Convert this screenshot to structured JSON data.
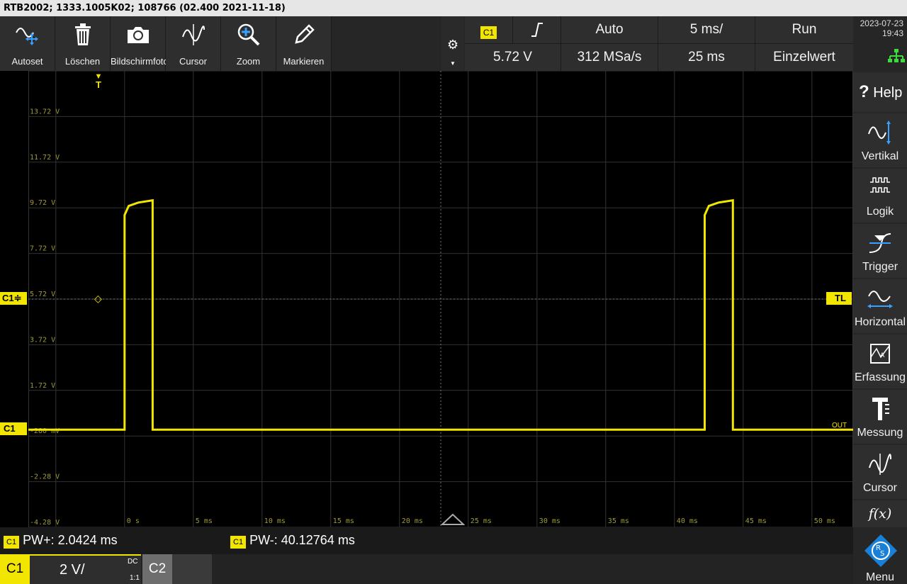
{
  "title_bar": "RTB2002; 1333.1005K02; 108766 (02.400 2021-11-18)",
  "toolbar": [
    {
      "icon": "autoset-icon",
      "label": "Autoset"
    },
    {
      "icon": "trash-icon",
      "label": "Löschen"
    },
    {
      "icon": "camera-icon",
      "label": "Bildschirmfoto"
    },
    {
      "icon": "cursor-wave-icon",
      "label": "Cursor"
    },
    {
      "icon": "zoom-icon",
      "label": "Zoom"
    },
    {
      "icon": "pencil-icon",
      "label": "Markieren"
    }
  ],
  "info": {
    "trigger_source": "C1",
    "trigger_slope_icon": "rising-edge-icon",
    "trigger_mode": "Auto",
    "time_per_div": "5 ms/",
    "run_state": "Run",
    "trigger_level": "5.72 V",
    "sample_rate": "312 MSa/s",
    "time_offset": "25 ms",
    "acquisition": "Einzelwert"
  },
  "datetime": {
    "date": "2023-07-23",
    "time": "19:43"
  },
  "sidebar": [
    {
      "icon": "help-icon",
      "label": "Help"
    },
    {
      "icon": "vertical-icon",
      "label": "Vertikal"
    },
    {
      "icon": "logic-icon",
      "label": "Logik"
    },
    {
      "icon": "trigger-icon",
      "label": "Trigger"
    },
    {
      "icon": "horizontal-icon",
      "label": "Horizontal"
    },
    {
      "icon": "acquisition-icon",
      "label": "Erfassung"
    },
    {
      "icon": "measure-icon",
      "label": "Messung"
    },
    {
      "icon": "cursor-icon",
      "label": "Cursor"
    },
    {
      "icon": "math-icon",
      "label": "f(x)"
    },
    {
      "icon": "rs-logo-icon",
      "label": "Menu"
    }
  ],
  "markers": {
    "trigger_time": "T",
    "trigger_level": "TL",
    "channel_level": "C1≑",
    "channel_ground": "C1",
    "out": "OUT"
  },
  "colors": {
    "trace": "#f2e600",
    "grid": "#3a3a3a",
    "accent": "#f2e600"
  },
  "chart_data": {
    "type": "line",
    "x_unit": "ms",
    "y_unit": "V",
    "xlim": [
      -7,
      53
    ],
    "ylim": [
      -4.28,
      15.72
    ],
    "x_ticks": [
      "0 s",
      "5 ms",
      "10 ms",
      "15 ms",
      "20 ms",
      "25 ms",
      "30 ms",
      "35 ms",
      "40 ms",
      "45 ms",
      "50 ms"
    ],
    "y_ticks": [
      "13.72 V",
      "11.72 V",
      "9.72 V",
      "7.72 V",
      "5.72 V",
      "3.72 V",
      "1.72 V",
      "-280 mV",
      "-2.28 V",
      "-4.28 V"
    ],
    "series": [
      {
        "x": [
          -7,
          0,
          0,
          0.3,
          1.0,
          2.04,
          2.04,
          42.2,
          42.2,
          42.5,
          43.2,
          44.25,
          44.25,
          53
        ],
        "y": [
          0.0,
          0.0,
          9.4,
          9.8,
          9.95,
          10.05,
          0.0,
          0.0,
          9.4,
          9.8,
          9.95,
          10.05,
          0.0,
          0.0
        ]
      }
    ]
  },
  "measurements": [
    {
      "badge": "C1",
      "text": "PW+: 2.0424 ms"
    },
    {
      "badge": "C1",
      "text": "PW-: 40.12764 ms"
    }
  ],
  "channel": {
    "c1_label": "C1",
    "scale": "2 V/",
    "coupling": "DC",
    "probe": "1:1",
    "c2_label": "C2"
  }
}
